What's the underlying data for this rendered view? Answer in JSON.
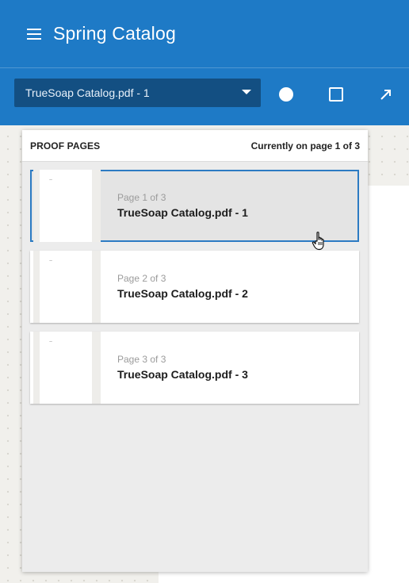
{
  "header": {
    "title": "Spring Catalog",
    "color": "#1e7ac6"
  },
  "toolbar": {
    "document_select": {
      "value": "TrueSoap Catalog.pdf - 1"
    },
    "tools": [
      {
        "icon": "circle-icon"
      },
      {
        "icon": "rectangle-icon"
      },
      {
        "icon": "arrow-icon"
      }
    ]
  },
  "proof_panel": {
    "title": "PROOF PAGES",
    "status": "Currently on page 1 of 3",
    "pages": [
      {
        "page_label": "Page 1 of 3",
        "name": "TrueSoap Catalog.pdf - 1",
        "thumb_mark": "~",
        "selected": true
      },
      {
        "page_label": "Page 2 of 3",
        "name": "TrueSoap Catalog.pdf - 2",
        "thumb_mark": "~",
        "selected": false
      },
      {
        "page_label": "Page 3 of 3",
        "name": "TrueSoap Catalog.pdf - 3",
        "thumb_mark": "~",
        "selected": false
      }
    ]
  },
  "colors": {
    "accent": "#1e7ac6",
    "select_bg": "#134f82",
    "selection_border": "#2c7bc3"
  }
}
